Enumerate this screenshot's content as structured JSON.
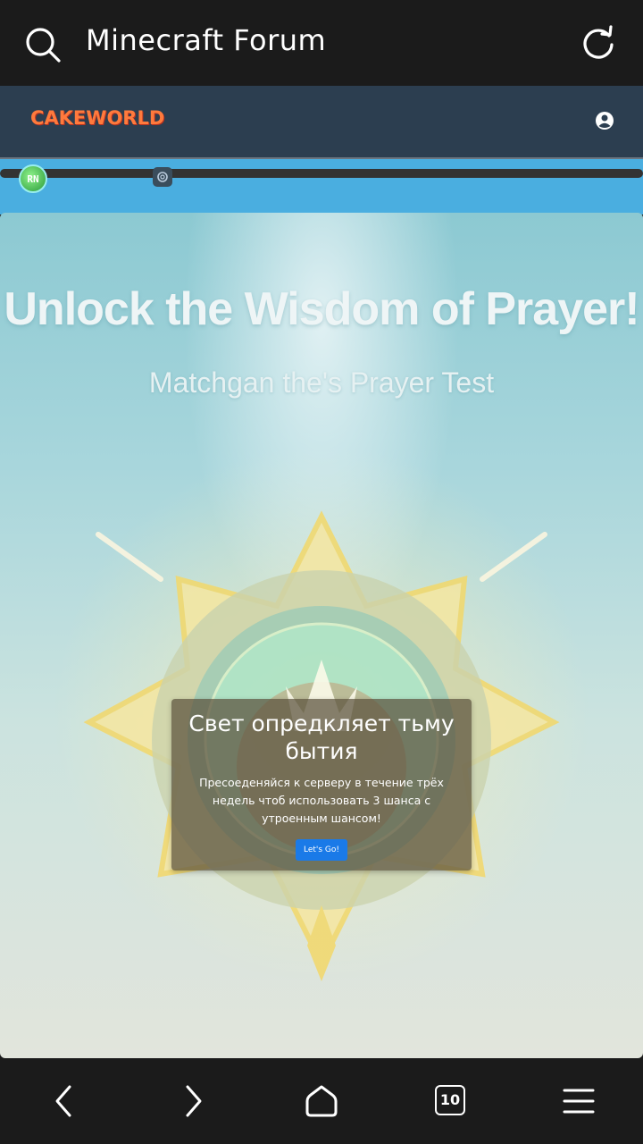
{
  "browser": {
    "title": "Minecraft Forum",
    "tab_count": "10"
  },
  "site": {
    "logo": "CAKEWORLD",
    "avatar_text": "RN"
  },
  "banner": {
    "headline": "Unlock the Wisdom of Prayer!",
    "subhead": "Matchgan the's Prayer Test"
  },
  "card": {
    "title": "Свет опредкляет тьму бытия",
    "text": "Пресоеденяйся к серверу в течение трёх недель чтоб использовать 3 шанса с утроенным шансом!",
    "button": "Let's Go!"
  },
  "colors": {
    "header": "#2c3e50",
    "strip": "#4aaee0",
    "button": "#1a7ae8"
  }
}
